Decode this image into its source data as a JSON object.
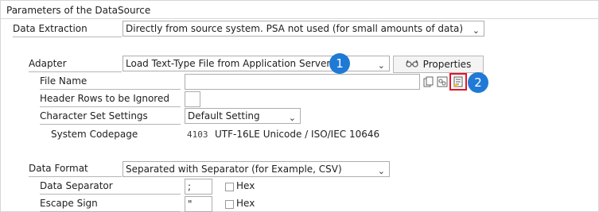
{
  "group_title": "Parameters of the DataSource",
  "data_extraction": {
    "label": "Data Extraction",
    "value": "Directly from source system. PSA not used (for small amounts of data)"
  },
  "adapter": {
    "label": "Adapter",
    "value": "Load Text-Type File from Application Server",
    "properties_label": "Properties",
    "properties_icon": "glasses-icon"
  },
  "file_name": {
    "label": "File Name",
    "value": ""
  },
  "header_rows": {
    "label": "Header Rows to be Ignored",
    "value": ""
  },
  "charset": {
    "label": "Character Set Settings",
    "value": "Default Setting"
  },
  "codepage": {
    "label": "System Codepage",
    "code": "4103",
    "description": "UTF-16LE Unicode / ISO/IEC 10646"
  },
  "data_format": {
    "label": "Data Format",
    "value": "Separated with Separator (for Example, CSV)"
  },
  "data_separator": {
    "label": "Data Separator",
    "value": ";",
    "hex_label": "Hex"
  },
  "escape_sign": {
    "label": "Escape Sign",
    "value": "\"",
    "hex_label": "Hex"
  },
  "callouts": {
    "one": "1",
    "two": "2"
  },
  "colors": {
    "callout_blue": "#1f7ad6",
    "highlight_red": "#e0142a"
  }
}
